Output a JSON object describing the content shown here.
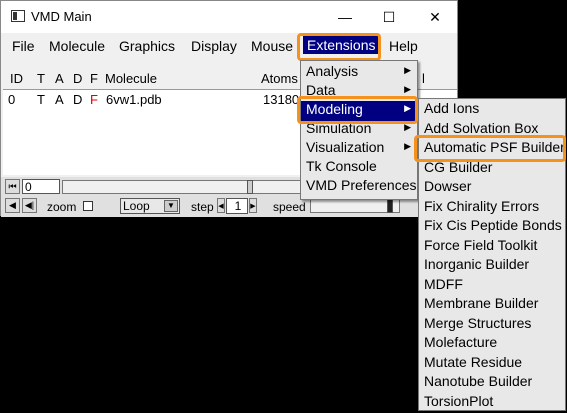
{
  "window": {
    "title": "VMD Main",
    "minimize": "—",
    "maximize": "☐",
    "close": "✕"
  },
  "menubar": [
    "File",
    "Molecule",
    "Graphics",
    "Display",
    "Mouse",
    "Extensions",
    "Help"
  ],
  "columns": {
    "id": "ID",
    "t": "T",
    "a": "A",
    "d": "D",
    "f": "F",
    "molecule": "Molecule",
    "atoms": "Atoms",
    "frames_partial": "l"
  },
  "molecules": [
    {
      "id": "0",
      "t": "T",
      "a": "A",
      "d": "D",
      "f": "F",
      "name": "6vw1.pdb",
      "atoms": "13180"
    }
  ],
  "controls": {
    "frame": "0",
    "zoom_label": "zoom",
    "loop": "Loop",
    "step_label": "step",
    "step_value": "1",
    "speed_label": "speed"
  },
  "extensions_menu": [
    "Analysis",
    "Data",
    "Modeling",
    "Simulation",
    "Visualization",
    "Tk Console",
    "VMD Preferences"
  ],
  "modeling_menu": [
    "Add Ions",
    "Add Solvation Box",
    "Automatic PSF Builder",
    "CG Builder",
    "Dowser",
    "Fix Chirality Errors",
    "Fix Cis Peptide Bonds",
    "Force Field Toolkit",
    "Inorganic Builder",
    "MDFF",
    "Membrane Builder",
    "Merge Structures",
    "Molefacture",
    "Mutate Residue",
    "Nanotube Builder",
    "TorsionPlot"
  ],
  "colors": {
    "highlight": "#f5921e",
    "selection": "#000080",
    "frozen_flag": "#e00000"
  }
}
